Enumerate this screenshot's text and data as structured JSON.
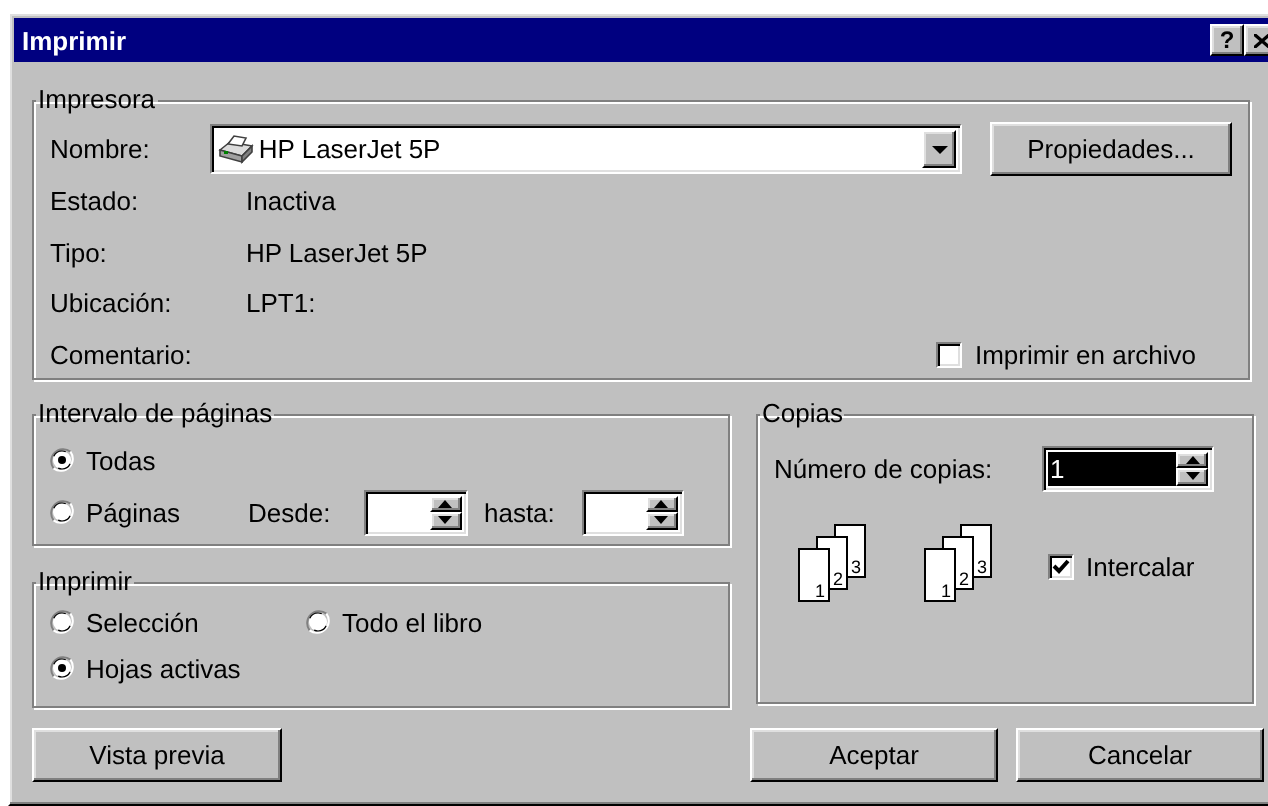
{
  "window": {
    "title": "Imprimir",
    "help_button": "?"
  },
  "printer": {
    "label": "Impresora",
    "name_label": "Nombre:",
    "name_value": "HP LaserJet 5P",
    "properties_button": "Propiedades...",
    "info": [
      {
        "label": "Estado:",
        "value": "Inactiva"
      },
      {
        "label": "Tipo:",
        "value": "HP LaserJet 5P"
      },
      {
        "label": "Ubicación:",
        "value": "LPT1:"
      },
      {
        "label": "Comentario:"
      }
    ],
    "print_to_file": {
      "label": "Imprimir en archivo",
      "checked": false
    }
  },
  "page_range": {
    "label": "Intervalo de páginas",
    "options": [
      {
        "label": "Todas",
        "selected": true
      },
      {
        "label": "Páginas",
        "selected": false
      }
    ],
    "from_label": "Desde:",
    "to_label": "hasta:"
  },
  "print_what": {
    "label": "Imprimir",
    "options": [
      {
        "label": "Selección",
        "selected": false
      },
      {
        "label": "Todo el libro",
        "selected": false
      },
      {
        "label": "Hojas activas",
        "selected": true
      }
    ]
  },
  "copies": {
    "label": "Copias",
    "count_label": "Número de copias:",
    "count_value": "1",
    "value_highlighted": true,
    "collate_stacks": [
      [
        "1",
        "2",
        "3"
      ],
      [
        "1",
        "2",
        "3"
      ]
    ],
    "collate": {
      "label": "Intercalar",
      "checked": true
    }
  },
  "buttons": [
    {
      "label": "Vista previa"
    },
    {
      "label": "Aceptar"
    },
    {
      "label": "Cancelar"
    }
  ]
}
